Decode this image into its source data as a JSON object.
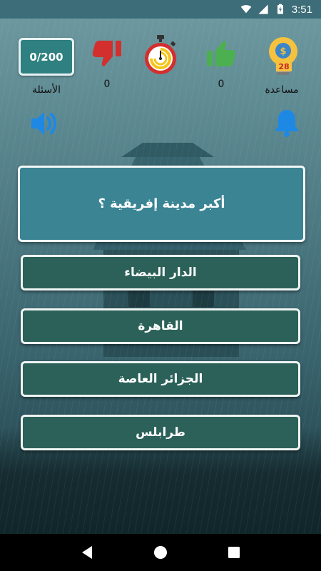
{
  "status_bar": {
    "time": "3:51",
    "icons": [
      "wifi-icon",
      "signal-icon",
      "battery-icon"
    ]
  },
  "header": {
    "questions_counter": "0/200",
    "questions_label": "الأسئلة",
    "wrong_count": "0",
    "correct_count": "0",
    "help_label": "مساعدة",
    "help_coins": "28",
    "icons": {
      "wrong": "thumbs-down-icon",
      "timer": "stopwatch-icon",
      "correct": "thumbs-up-icon",
      "help": "lightbulb-coin-icon",
      "sound": "speaker-icon",
      "notifications": "bell-icon"
    }
  },
  "question": {
    "text": "أكبر مدينة إفريقية ؟"
  },
  "answers": [
    {
      "label": "الدار البيضاء"
    },
    {
      "label": "القاهرة"
    },
    {
      "label": "الجزائر العاصة"
    },
    {
      "label": "طرابلس"
    }
  ],
  "colors": {
    "accent": "#2f8080",
    "question_bg": "#3a8494",
    "answer_bg": "#2b6158",
    "thumbs_up": "#4caf50",
    "thumbs_down": "#d32f2f",
    "icon_blue": "#1e88e5",
    "status_bar": "#3c6d78"
  },
  "nav_bar": {
    "icons": [
      "back-icon",
      "home-icon",
      "recents-icon"
    ]
  }
}
